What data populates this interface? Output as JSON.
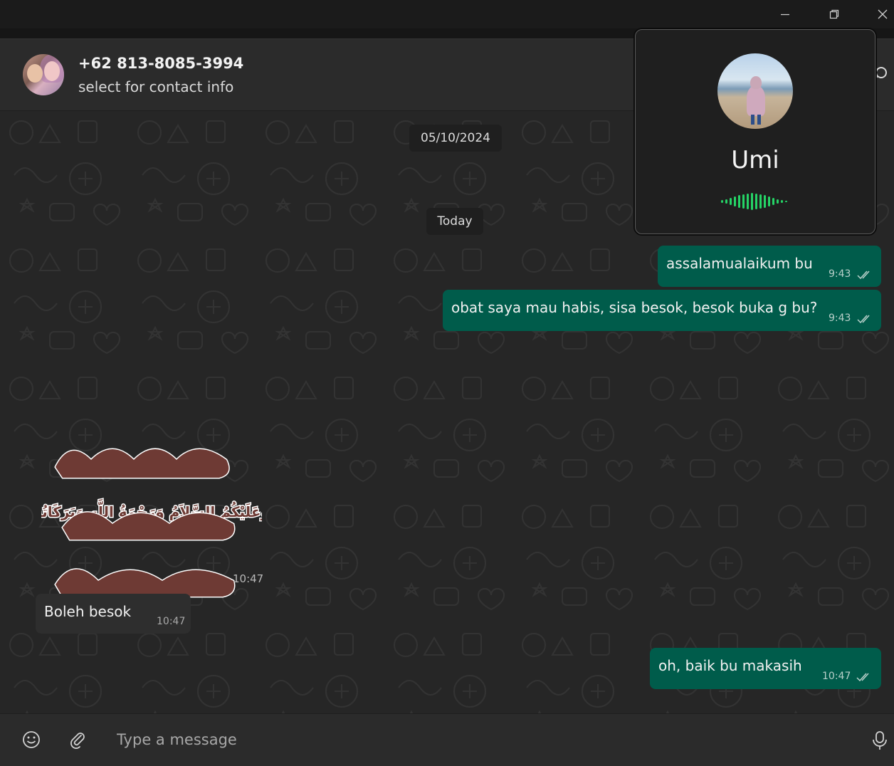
{
  "header": {
    "contact_name": "+62 813-8085-3994",
    "contact_subtitle": "select for contact info"
  },
  "chat": {
    "date_chips": [
      "05/10/2024",
      "Today"
    ],
    "messages": [
      {
        "direction": "out",
        "text": "assalamualaikum bu",
        "time": "9:43",
        "status": "read"
      },
      {
        "direction": "out",
        "text": "obat saya mau habis, sisa besok, besok buka g bu?",
        "time": "9:43",
        "status": "read"
      },
      {
        "direction": "in",
        "type": "sticker",
        "text": "وَعَلَيْكُمُ السَّلاَمُ وَرَحْمَةُ اللَّهِ وَبَرَكَاتُهُ",
        "time": "10:47"
      },
      {
        "direction": "in",
        "text": "Boleh besok",
        "time": "10:47"
      },
      {
        "direction": "out",
        "text": "oh, baik bu makasih",
        "time": "10:47",
        "status": "read"
      }
    ]
  },
  "composer": {
    "placeholder": "Type a message"
  },
  "call_popup": {
    "caller_name": "Umi"
  },
  "colors": {
    "outgoing_bubble": "#005c4b",
    "incoming_bubble": "#2e2e2e",
    "call_wave": "#25d366"
  },
  "icons": {
    "titlebar": [
      "minimize-icon",
      "restore-icon",
      "close-icon"
    ],
    "header": [
      "search-icon"
    ],
    "composer": [
      "emoji-icon",
      "attach-icon",
      "microphone-icon"
    ],
    "message_status": "double-check-icon"
  }
}
